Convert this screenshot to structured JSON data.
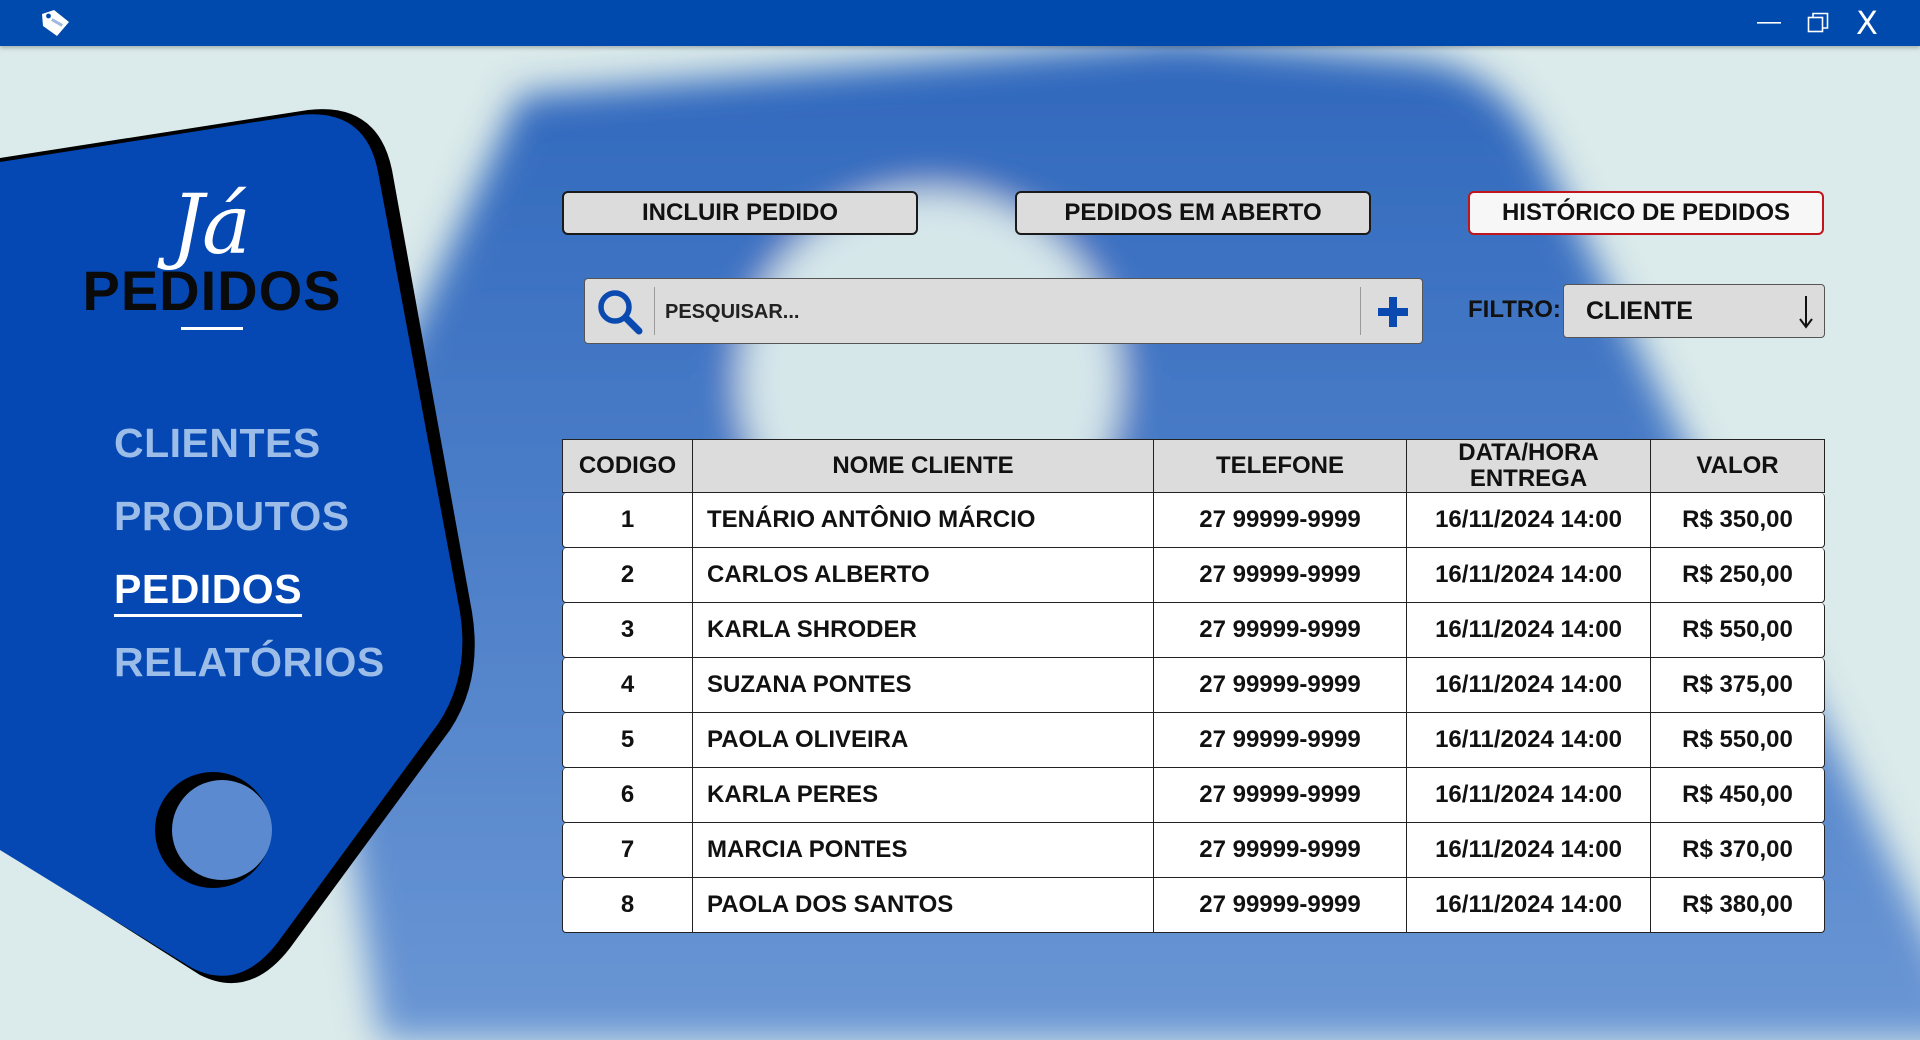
{
  "window": {
    "close_label": "X"
  },
  "logo": {
    "script_text": "Já",
    "word": "PEDIDOS"
  },
  "sidebar": {
    "items": [
      {
        "label": "CLIENTES",
        "active": false
      },
      {
        "label": "PRODUTOS",
        "active": false
      },
      {
        "label": "PEDIDOS",
        "active": true
      },
      {
        "label": "RELATÓRIOS",
        "active": false
      }
    ]
  },
  "toolbar": {
    "incluir_label": "INCLUIR PEDIDO",
    "abertos_label": "PEDIDOS EM ABERTO",
    "historico_label": "HISTÓRICO DE PEDIDOS"
  },
  "search": {
    "placeholder": "PESQUISAR..."
  },
  "filter": {
    "label": "FILTRO:",
    "selected": "CLIENTE"
  },
  "table": {
    "headers": {
      "codigo": "CODIGO",
      "nome": "NOME CLIENTE",
      "telefone": "TELEFONE",
      "data_line1": "DATA/HORA",
      "data_line2": "ENTREGA",
      "valor": "VALOR"
    },
    "rows": [
      {
        "codigo": "1",
        "nome": "TENÁRIO ANTÔNIO MÁRCIO",
        "telefone": "27 99999-9999",
        "data": "16/11/2024 14:00",
        "valor": "R$ 350,00"
      },
      {
        "codigo": "2",
        "nome": "CARLOS ALBERTO",
        "telefone": "27 99999-9999",
        "data": "16/11/2024 14:00",
        "valor": "R$ 250,00"
      },
      {
        "codigo": "3",
        "nome": "KARLA SHRODER",
        "telefone": "27 99999-9999",
        "data": "16/11/2024 14:00",
        "valor": "R$ 550,00"
      },
      {
        "codigo": "4",
        "nome": "SUZANA PONTES",
        "telefone": "27 99999-9999",
        "data": "16/11/2024 14:00",
        "valor": "R$ 375,00"
      },
      {
        "codigo": "5",
        "nome": "PAOLA OLIVEIRA",
        "telefone": "27 99999-9999",
        "data": "16/11/2024 14:00",
        "valor": "R$ 550,00"
      },
      {
        "codigo": "6",
        "nome": "KARLA PERES",
        "telefone": "27 99999-9999",
        "data": "16/11/2024 14:00",
        "valor": "R$ 450,00"
      },
      {
        "codigo": "7",
        "nome": "MARCIA PONTES",
        "telefone": "27 99999-9999",
        "data": "16/11/2024 14:00",
        "valor": "R$ 370,00"
      },
      {
        "codigo": "8",
        "nome": "PAOLA DOS SANTOS",
        "telefone": "27 99999-9999",
        "data": "16/11/2024 14:00",
        "valor": "R$ 380,00"
      }
    ]
  },
  "colors": {
    "titlebar": "#0049ad",
    "sidebar": "#0548b3",
    "nav_inactive": "#9dbde9",
    "history_border": "#c0151b",
    "accent_icon": "#0a4ab0"
  }
}
